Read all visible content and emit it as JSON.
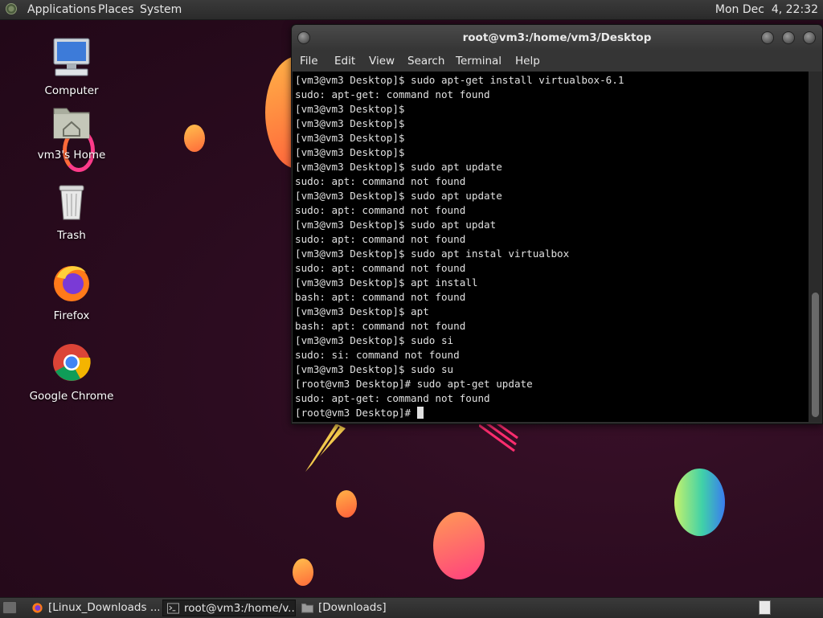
{
  "top_panel": {
    "menus": [
      "Applications",
      "Places",
      "System"
    ],
    "clock": "Mon Dec  4, 22:32"
  },
  "desktop_icons": {
    "computer": "Computer",
    "home": "vm3's Home",
    "trash": "Trash",
    "firefox": "Firefox",
    "chrome": "Google Chrome"
  },
  "terminal": {
    "title": "root@vm3:/home/vm3/Desktop",
    "menu": [
      "File",
      "Edit",
      "View",
      "Search",
      "Terminal",
      "Help"
    ],
    "lines": [
      "[vm3@vm3 Desktop]$ sudo apt-get install virtualbox-6.1",
      "sudo: apt-get: command not found",
      "[vm3@vm3 Desktop]$",
      "[vm3@vm3 Desktop]$",
      "[vm3@vm3 Desktop]$",
      "[vm3@vm3 Desktop]$",
      "[vm3@vm3 Desktop]$ sudo apt update",
      "sudo: apt: command not found",
      "[vm3@vm3 Desktop]$ sudo apt update",
      "sudo: apt: command not found",
      "[vm3@vm3 Desktop]$ sudo apt updat",
      "sudo: apt: command not found",
      "[vm3@vm3 Desktop]$ sudo apt instal virtualbox",
      "sudo: apt: command not found",
      "[vm3@vm3 Desktop]$ apt install",
      "bash: apt: command not found",
      "[vm3@vm3 Desktop]$ apt",
      "bash: apt: command not found",
      "[vm3@vm3 Desktop]$ sudo si",
      "sudo: si: command not found",
      "[vm3@vm3 Desktop]$ sudo su",
      "[root@vm3 Desktop]# sudo apt-get update",
      "sudo: apt-get: command not found"
    ],
    "prompt": "[root@vm3 Desktop]# "
  },
  "taskbar": {
    "tasks": [
      {
        "label": "[Linux_Downloads ...",
        "icon": "firefox-icon",
        "active": false
      },
      {
        "label": "root@vm3:/home/v...",
        "icon": "terminal-icon",
        "active": true
      },
      {
        "label": "[Downloads]",
        "icon": "folder-icon",
        "active": false
      }
    ]
  },
  "colors": {
    "desktop_bg": "#2a0d1f",
    "panel_bg": "#333333",
    "terminal_bg": "#000000",
    "terminal_fg": "#e0e0e0"
  }
}
